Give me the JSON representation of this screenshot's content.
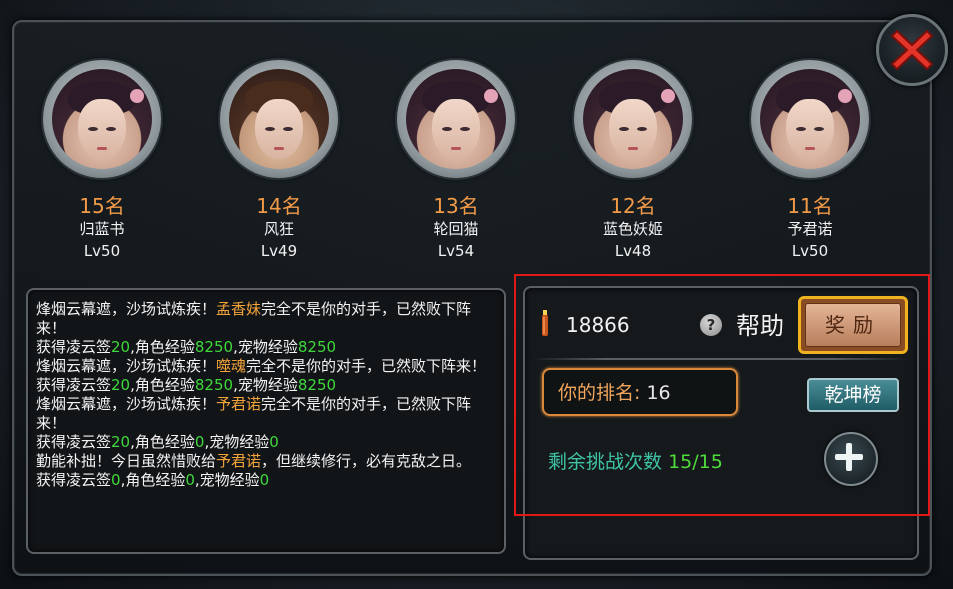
{
  "players": [
    {
      "rank": "15名",
      "name": "归蓝书",
      "level": "Lv50",
      "avatar": "female"
    },
    {
      "rank": "14名",
      "name": "风狂",
      "level": "Lv49",
      "avatar": "male"
    },
    {
      "rank": "13名",
      "name": "轮回猫",
      "level": "Lv54",
      "avatar": "female"
    },
    {
      "rank": "12名",
      "name": "蓝色妖姬",
      "level": "Lv48",
      "avatar": "female"
    },
    {
      "rank": "11名",
      "name": "予君诺",
      "level": "Lv50",
      "avatar": "female"
    }
  ],
  "log": {
    "e1_a": "烽烟云幕遮，沙场试炼疾！",
    "e1_name": "孟香妹",
    "e1_b": "完全不是你的对手，已然败下阵来！",
    "r1_a": "获得凌云签",
    "r1_v1": "20",
    "r1_b": ",角色经验",
    "r1_v2": "8250",
    "r1_c": ",宠物经验",
    "r1_v3": "8250",
    "e2_a": "烽烟云幕遮，沙场试炼疾！",
    "e2_name": "噬魂",
    "e2_b": "完全不是你的对手，已然败下阵来！",
    "r2_a": "获得凌云签",
    "r2_v1": "20",
    "r2_b": ",角色经验",
    "r2_v2": "8250",
    "r2_c": ",宠物经验",
    "r2_v3": "8250",
    "e3_a": "烽烟云幕遮，沙场试炼疾！",
    "e3_name": "予君诺",
    "e3_b": "完全不是你的对手，已然败下阵来！",
    "r3_a": "获得凌云签",
    "r3_v1": "20",
    "r3_b": ",角色经验",
    "r3_v2": "0",
    "r3_c": ",宠物经验",
    "r3_v3": "0",
    "e4_a": "勤能补拙！今日虽然惜败给",
    "e4_name": "予君诺",
    "e4_b": "，但继续修行，必有克敌之日。",
    "r4_a": "获得凌云签",
    "r4_v1": "0",
    "r4_b": ",角色经验",
    "r4_v2": "0",
    "r4_c": ",宠物经验",
    "r4_v3": "0"
  },
  "panel": {
    "currency_value": "18866",
    "help_icon_text": "?",
    "help_label": "帮助",
    "reward_button": "奖励",
    "my_rank_label": "你的排名:",
    "my_rank_value": "16",
    "board_button": "乾坤榜",
    "remaining_label": "剩余挑战次数",
    "remaining_value": "15/15"
  },
  "colors": {
    "rank_orange": "#f29a48",
    "highlight_name": "#f2a43a",
    "highlight_value": "#3fd83b",
    "selection_box": "#e01818",
    "reward_border": "#f0b21f"
  },
  "icons": {
    "close": "close-x-icon",
    "currency": "incense-icon",
    "help": "question-mark-icon",
    "add": "plus-icon"
  }
}
